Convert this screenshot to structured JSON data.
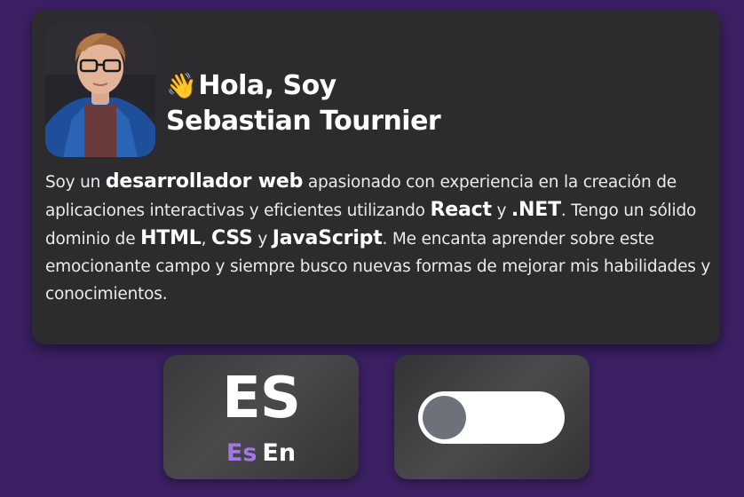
{
  "profile": {
    "wave_emoji": "👋",
    "greeting": "Hola, Soy",
    "name": "Sebastian Tournier"
  },
  "bio": {
    "t1": "Soy un ",
    "b1": "desarrollador web",
    "t2": " apasionado con experiencia en la creación de aplicaciones interactivas y eficientes utilizando ",
    "b2": "React",
    "t3": " y ",
    "b3": ".NET",
    "t4": ". Tengo un sólido dominio de ",
    "b4": "HTML",
    "t5": ", ",
    "b5": "CSS",
    "t6": " y ",
    "b6": "JavaScript",
    "t7": ". Me encanta aprender sobre este emocionante campo y siempre busco nuevas formas de mejorar mis habilidades y conocimientos."
  },
  "language": {
    "current": "ES",
    "options": [
      "Es",
      "En"
    ],
    "active_color": "#a277e8"
  },
  "theme_toggle": {
    "state": "off",
    "track_color": "#ffffff",
    "knob_color": "#6d727a"
  },
  "colors": {
    "background": "#3b2063",
    "card": "#2c2b2d"
  }
}
